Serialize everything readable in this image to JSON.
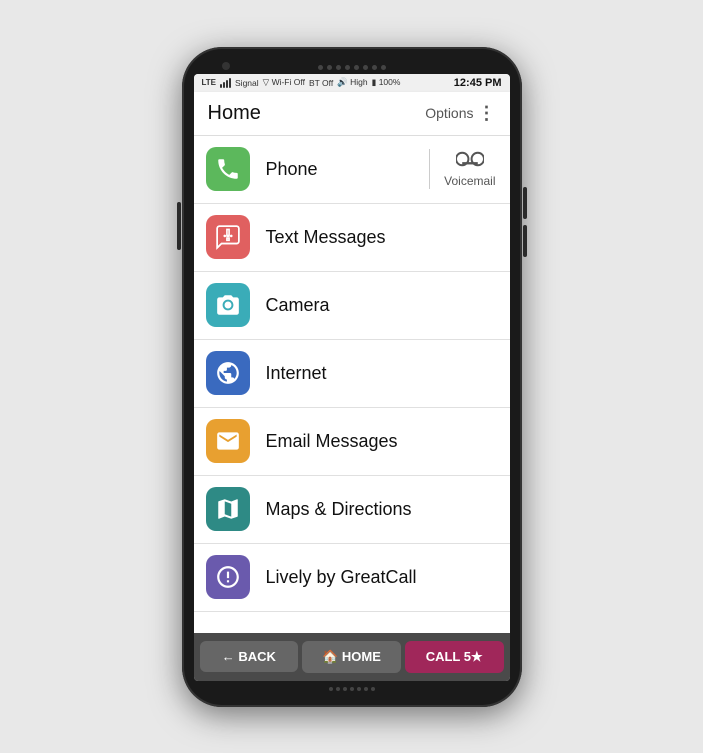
{
  "phone": {
    "status_bar": {
      "signal": "Signal",
      "wifi": "Wi-Fi Off",
      "bt": "BT Off",
      "sound": "High",
      "battery": "100%",
      "time": "12:45 PM",
      "lte": "LTE"
    },
    "header": {
      "title": "Home",
      "options_label": "Options",
      "menu_icon": "⋮"
    },
    "apps": [
      {
        "id": "phone",
        "label": "Phone",
        "icon_char": "📞",
        "icon_class": "icon-green",
        "has_voicemail": true,
        "voicemail_label": "Voicemail"
      },
      {
        "id": "text",
        "label": "Text Messages",
        "icon_char": "💬",
        "icon_class": "icon-red",
        "has_voicemail": false
      },
      {
        "id": "camera",
        "label": "Camera",
        "icon_char": "📷",
        "icon_class": "icon-teal",
        "has_voicemail": false
      },
      {
        "id": "internet",
        "label": "Internet",
        "icon_char": "🌐",
        "icon_class": "icon-blue",
        "has_voicemail": false
      },
      {
        "id": "email",
        "label": "Email Messages",
        "icon_char": "✉",
        "icon_class": "icon-orange",
        "has_voicemail": false
      },
      {
        "id": "maps",
        "label": "Maps & Directions",
        "icon_char": "🗺",
        "icon_class": "icon-teal2",
        "has_voicemail": false
      },
      {
        "id": "lively",
        "label": "Lively by GreatCall",
        "icon_char": "⚙",
        "icon_class": "icon-purple",
        "has_voicemail": false
      }
    ],
    "nav": {
      "back_label": "← BACK",
      "home_label": "🏠 HOME",
      "call_label": "CALL 5★"
    }
  }
}
